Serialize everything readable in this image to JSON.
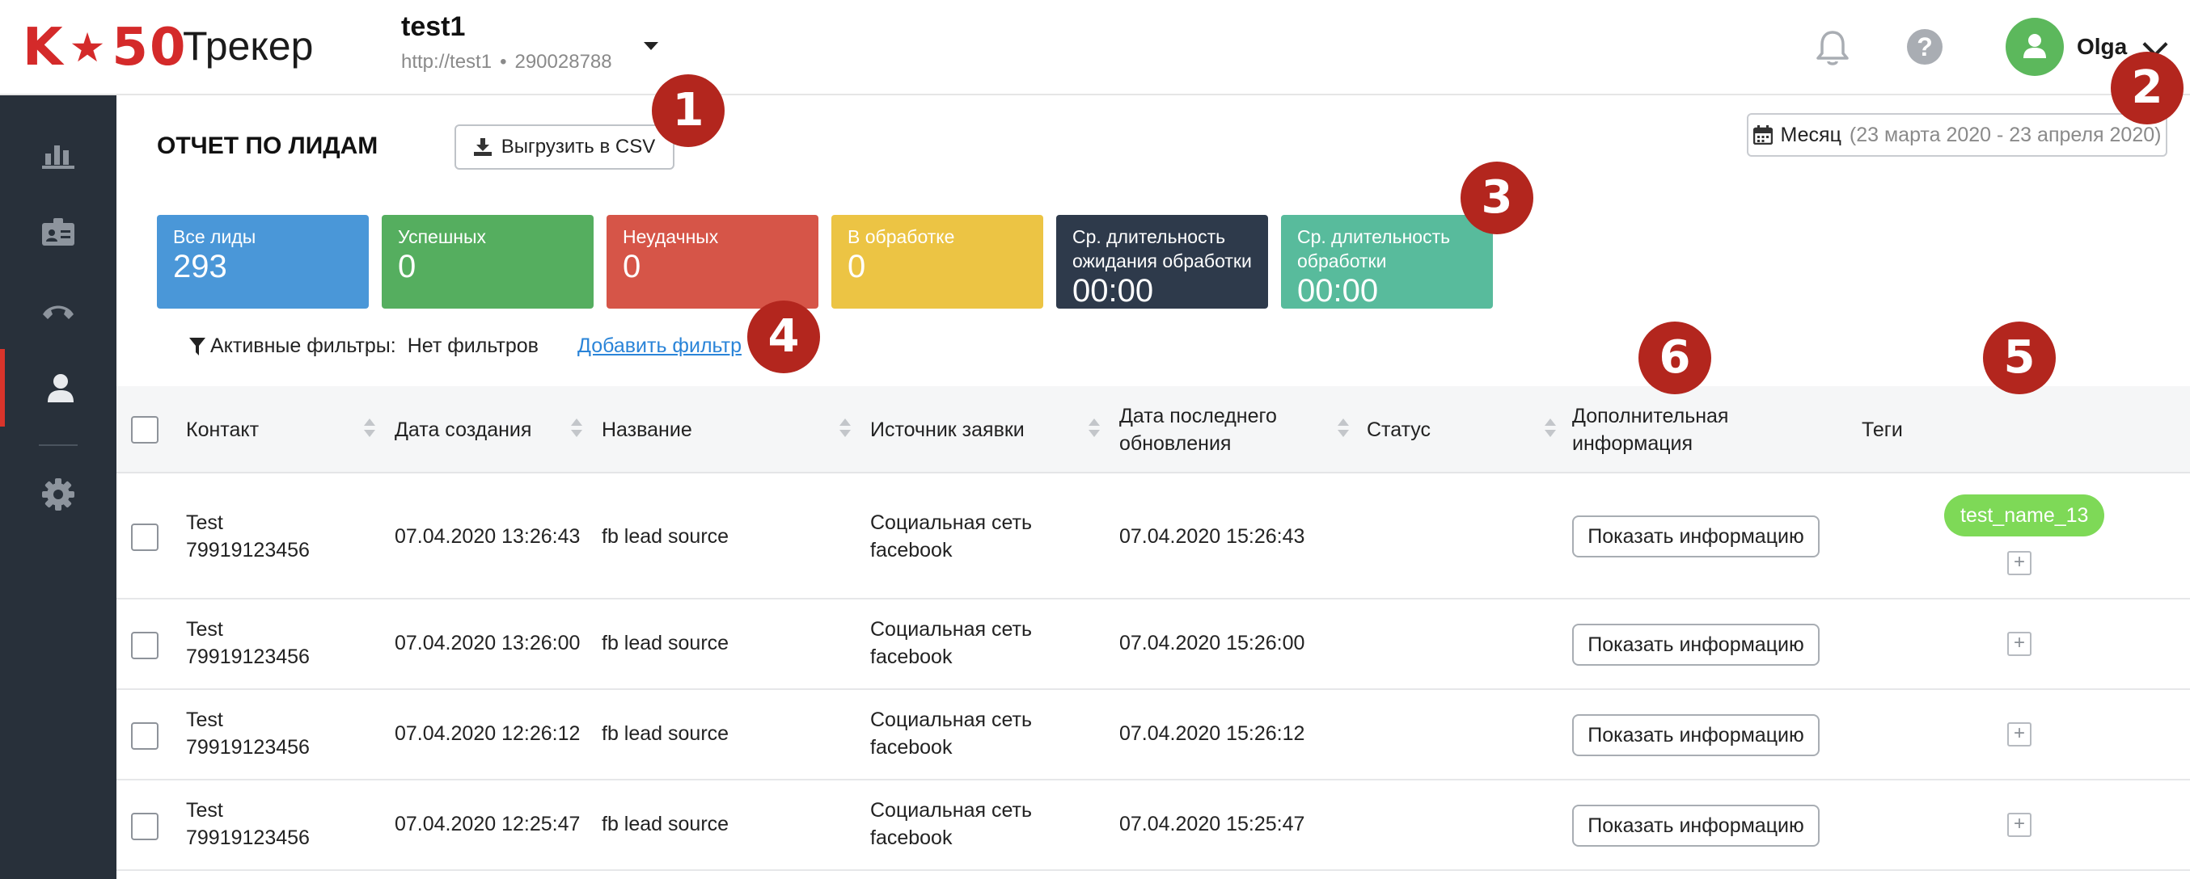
{
  "header": {
    "logo_left": "K",
    "logo_star": "★",
    "logo_right": "50",
    "app_name": "Трекер",
    "project_name": "test1",
    "project_url": "http://test1",
    "project_separator": "•",
    "project_id": "290028788",
    "help_symbol": "?",
    "user_name": "Olga"
  },
  "sidebar": {
    "items": [
      {
        "icon": "bar-chart-icon"
      },
      {
        "icon": "id-card-icon"
      },
      {
        "icon": "phone-icon"
      },
      {
        "icon": "user-icon",
        "active": true
      },
      {
        "icon": "gear-icon"
      }
    ],
    "active_color": "#d9342b"
  },
  "page": {
    "title": "ОТЧЕТ ПО ЛИДАМ",
    "export_label": "Выгрузить в CSV",
    "date_period": "Месяц",
    "date_range": "(23 марта 2020 - 23 апреля 2020)"
  },
  "stats": [
    {
      "label": "Все лиды",
      "value": "293",
      "color": "#4a97d8"
    },
    {
      "label": "Успешных",
      "value": "0",
      "color": "#55ae5f"
    },
    {
      "label": "Неудачных",
      "value": "0",
      "color": "#d65548"
    },
    {
      "label": "В обработке",
      "value": "0",
      "color": "#ecc444"
    },
    {
      "label": "Ср. длительность ожидания обработки",
      "value": "00:00",
      "color": "#2e3a4b"
    },
    {
      "label": "Ср. длительность обработки",
      "value": "00:00",
      "color": "#58bb9c"
    }
  ],
  "filters": {
    "label": "Активные фильтры:",
    "value": "Нет фильтров",
    "add_label": "Добавить фильтр"
  },
  "table": {
    "columns": [
      "Контакт",
      "Дата создания",
      "Название",
      "Источник заявки",
      "Дата последнего обновления",
      "Статус",
      "Дополнительная информация",
      "Теги"
    ],
    "show_info_label": "Показать информацию",
    "add_tag_symbol": "+",
    "rows": [
      {
        "contact_name": "Test",
        "contact_phone": "79919123456",
        "created": "07.04.2020 13:26:43",
        "name": "fb lead source",
        "source": "Социальная сеть facebook",
        "updated": "07.04.2020 15:26:43",
        "status": "",
        "tags": [
          "test_name_13"
        ]
      },
      {
        "contact_name": "Test",
        "contact_phone": "79919123456",
        "created": "07.04.2020 13:26:00",
        "name": "fb lead source",
        "source": "Социальная сеть facebook",
        "updated": "07.04.2020 15:26:00",
        "status": "",
        "tags": []
      },
      {
        "contact_name": "Test",
        "contact_phone": "79919123456",
        "created": "07.04.2020 12:26:12",
        "name": "fb lead source",
        "source": "Социальная сеть facebook",
        "updated": "07.04.2020 15:26:12",
        "status": "",
        "tags": []
      },
      {
        "contact_name": "Test",
        "contact_phone": "79919123456",
        "created": "07.04.2020 12:25:47",
        "name": "fb lead source",
        "source": "Социальная сеть facebook",
        "updated": "07.04.2020 15:25:47",
        "status": "",
        "tags": []
      }
    ]
  },
  "markers": [
    "1",
    "2",
    "3",
    "4",
    "5",
    "6"
  ],
  "marker_color": "#b3261e"
}
